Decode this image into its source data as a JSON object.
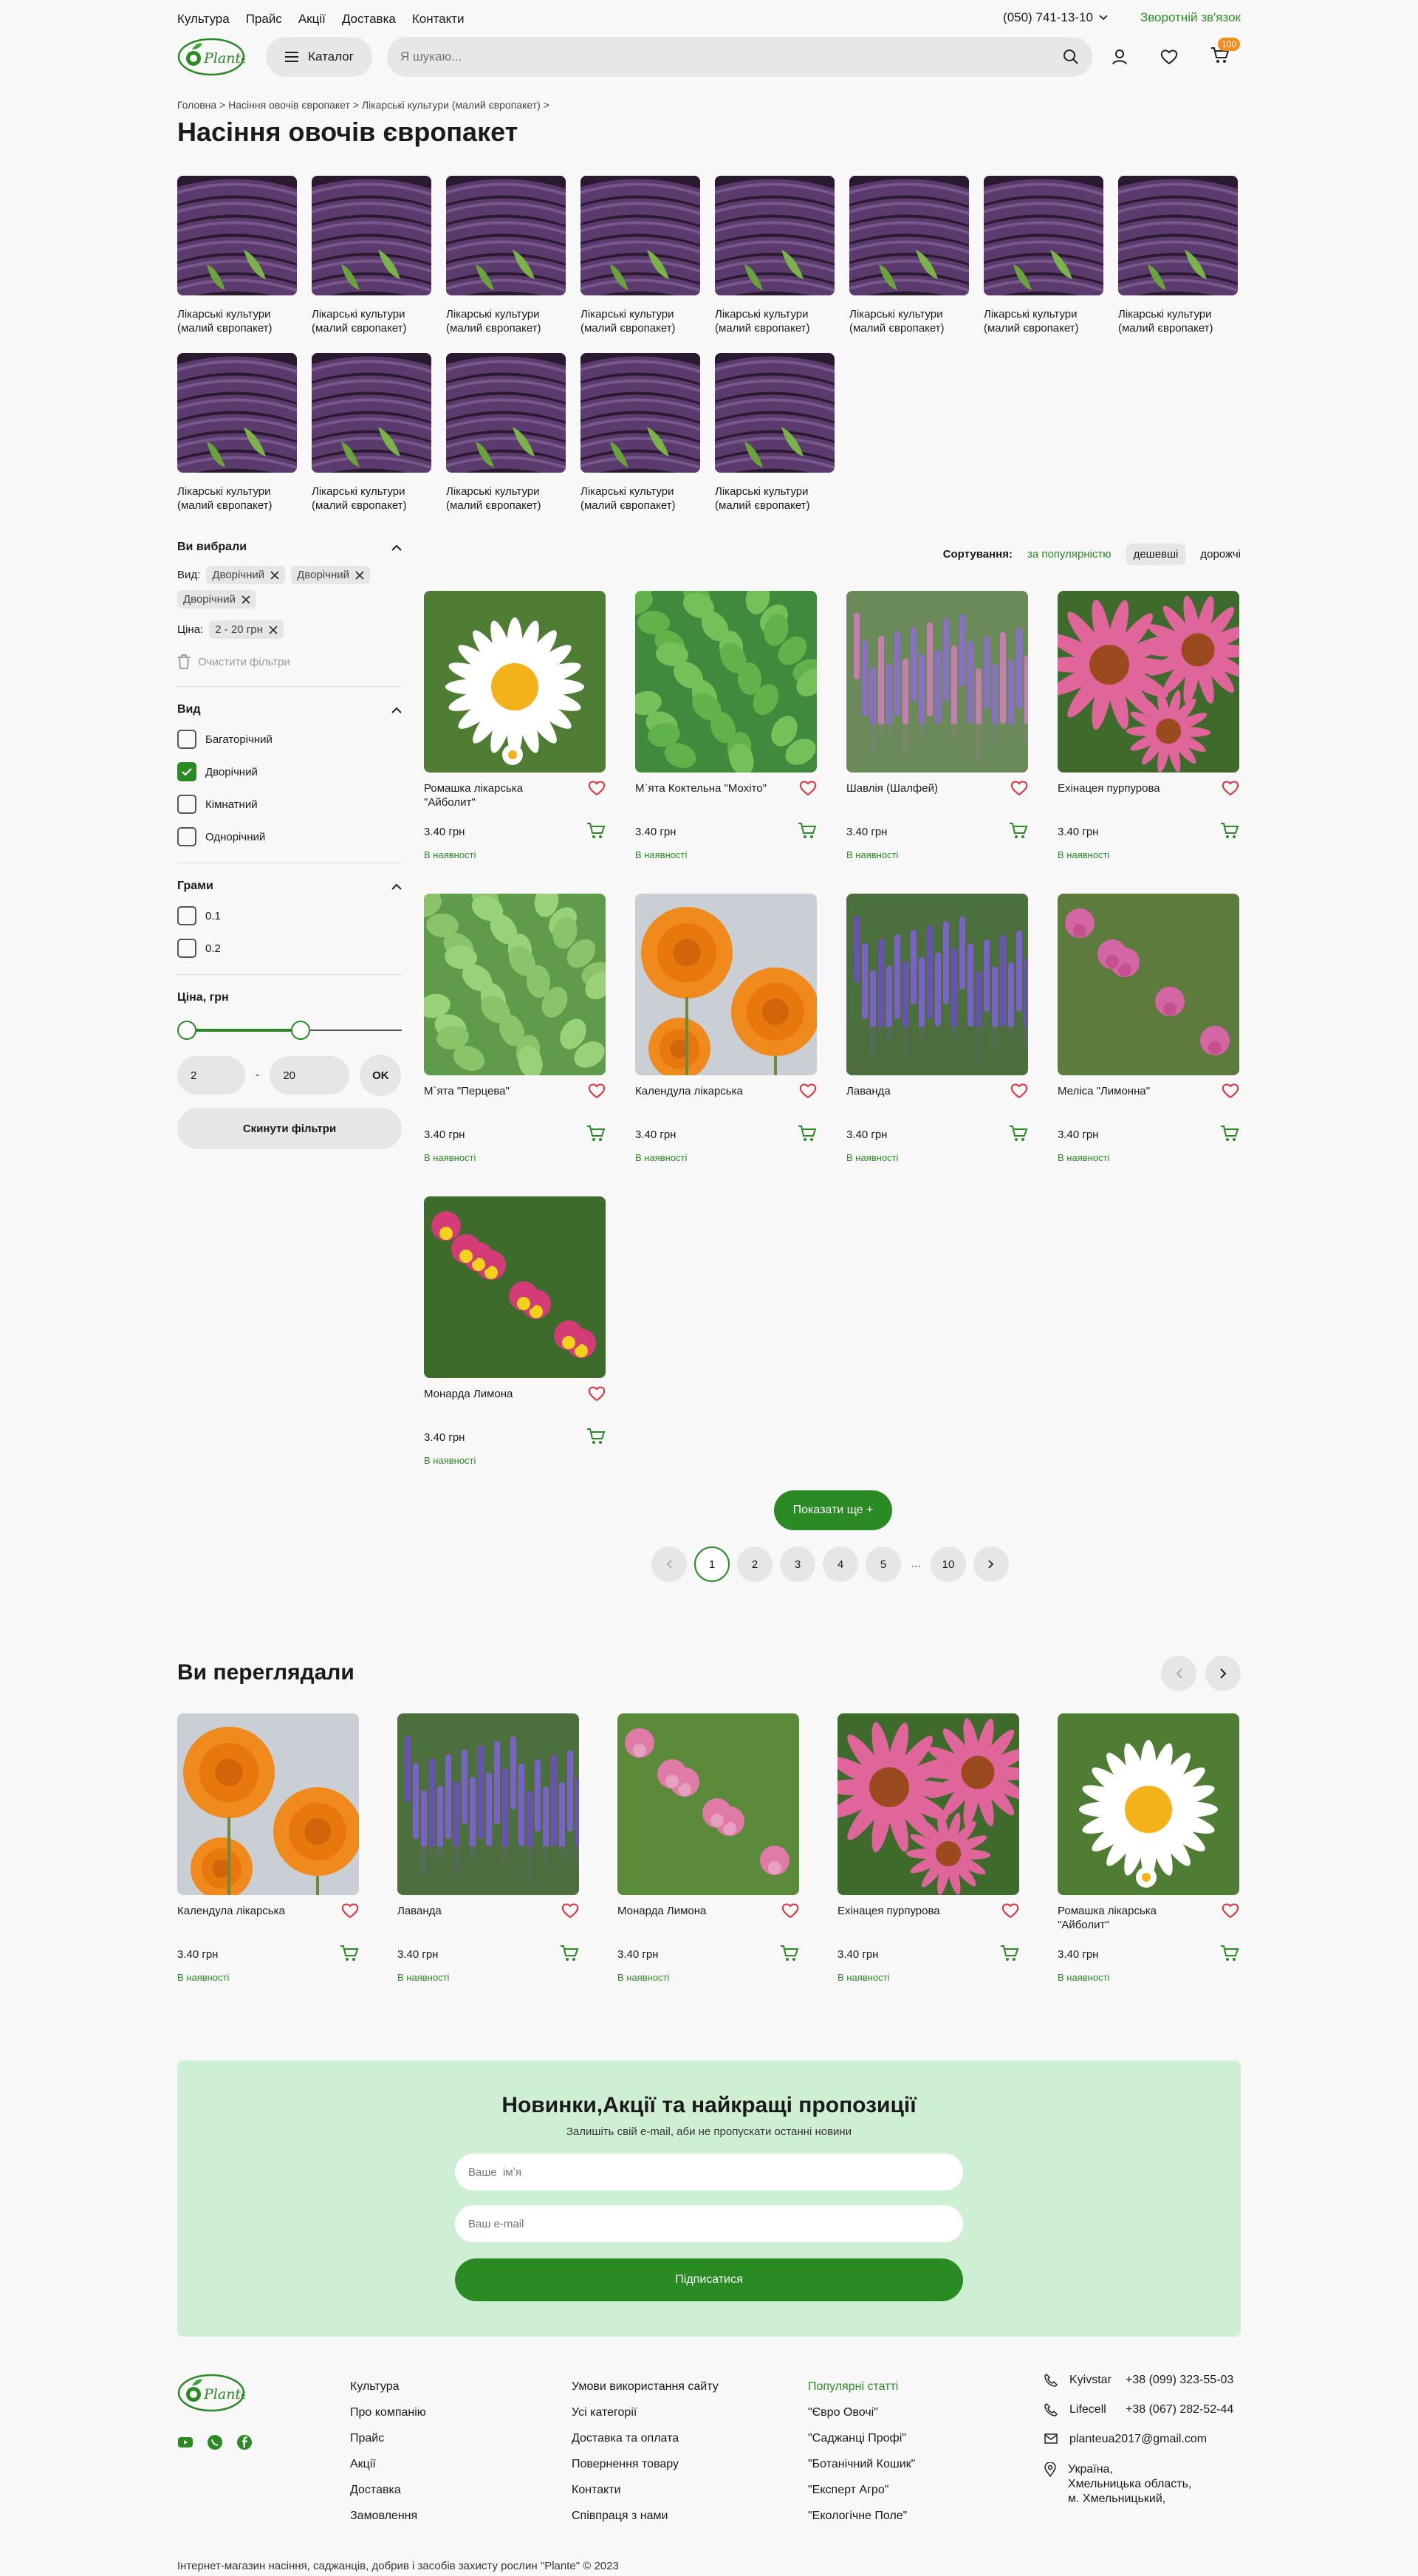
{
  "topnav": [
    "Культура",
    "Прайс",
    "Акції",
    "Доставка",
    "Контакти"
  ],
  "header": {
    "phone": "(050) 741-13-10",
    "feedback": "Зворотній зв'язок",
    "catalog": "Каталог",
    "search_placeholder": "Я шукаю...",
    "cart_count": "100",
    "logo_text": "Plante"
  },
  "breadcrumb": "Головна > Насіння овочів європакет > Лікарські культури (малий європакет) >",
  "title": "Насіння овочів європакет",
  "categories": [
    "Лікарські культури (малий європакет)",
    "Лікарські культури (малий європакет)",
    "Лікарські культури (малий європакет)",
    "Лікарські культури (малий європакет)",
    "Лікарські культури (малий європакет)",
    "Лікарські культури (малий європакет)",
    "Лікарські культури (малий європакет)",
    "Лікарські культури (малий європакет)",
    "Лікарські культури (малий європакет)",
    "Лікарські культури (малий європакет)",
    "Лікарські культури (малий європакет)",
    "Лікарські культури (малий європакет)",
    "Лікарські культури (малий європакет)"
  ],
  "filters": {
    "selected_title": "Ви вибрали",
    "vid_label": "Вид:",
    "vid_chips": [
      "Дворічний",
      "Дворічний",
      "Дворічний"
    ],
    "price_label": "Ціна:",
    "price_chip": "2 - 20 грн",
    "clear": "Очистити фільтри",
    "vid_title": "Вид",
    "vid_options": [
      "Багаторічний",
      "Дворічний",
      "Кімнатний",
      "Однорічний"
    ],
    "vid_checked": 1,
    "grams_title": "Грами",
    "grams_options": [
      "0.1",
      "0.2"
    ],
    "price_title": "Ціна, грн",
    "price_from": "2",
    "price_to": "20",
    "price_sep": "-",
    "ok": "OK",
    "reset": "Скинути фільтри"
  },
  "sort": {
    "label": "Сортування:",
    "options": [
      "за популярністю",
      "дешевші",
      "дорожчі"
    ]
  },
  "products": [
    {
      "name": "Ромашка лікарська \"Айболит\"",
      "price": "3.40 грн",
      "stock": "В наявності",
      "img": "daisy"
    },
    {
      "name": "М`ята Коктельна \"Мохіто\"",
      "price": "3.40 грн",
      "stock": "В наявності",
      "img": "mint"
    },
    {
      "name": "Шавлія (Шалфей)",
      "price": "3.40 грн",
      "stock": "В наявності",
      "img": "sage"
    },
    {
      "name": "Ехінацея пурпурова",
      "price": "3.40 грн",
      "stock": "В наявності",
      "img": "echinacea"
    },
    {
      "name": "М`ята \"Перцева\"",
      "price": "3.40 грн",
      "stock": "В наявності",
      "img": "pepmint"
    },
    {
      "name": "Календула лікарська",
      "price": "3.40 грн",
      "stock": "В наявності",
      "img": "calendula"
    },
    {
      "name": "Лаванда",
      "price": "3.40 грн",
      "stock": "В наявності",
      "img": "lavender"
    },
    {
      "name": "Меліса \"Лимонна\"",
      "price": "3.40 грн",
      "stock": "В наявності",
      "img": "melissa"
    },
    {
      "name": "Монарда Лимона",
      "price": "3.40 грн",
      "stock": "В наявності",
      "img": "monarda"
    }
  ],
  "show_more": "Показати ще +",
  "pagination": [
    "1",
    "2",
    "3",
    "4",
    "5",
    "...",
    "10"
  ],
  "viewed_title": "Ви переглядали",
  "viewed": [
    {
      "name": "Календула лікарська",
      "price": "3.40 грн",
      "stock": "В наявності",
      "img": "calendula"
    },
    {
      "name": "Лаванда",
      "price": "3.40 грн",
      "stock": "В наявності",
      "img": "lavender"
    },
    {
      "name": "Монарда Лимона",
      "price": "3.40 грн",
      "stock": "В наявності",
      "img": "monarda2"
    },
    {
      "name": "Ехінацея пурпурова",
      "price": "3.40 грн",
      "stock": "В наявності",
      "img": "echinacea"
    },
    {
      "name": "Ромашка лікарська \"Айболит\"",
      "price": "3.40 грн",
      "stock": "В наявності",
      "img": "daisy"
    }
  ],
  "newsletter": {
    "title": "Новинки,Акції та найкращі пропозиції",
    "subtitle": "Залишіть свій e-mail, аби не пропускати останні новини",
    "name_placeholder": "Ваше  імʼя",
    "email_placeholder": "Ваш e-mail",
    "submit": "Підписатися"
  },
  "footer": {
    "col1": [
      "Культура",
      "Про компанію",
      "Прайс",
      "Акції",
      "Доставка",
      "Замовлення"
    ],
    "col2": [
      "Умови використання сайту",
      "Усі категорії",
      "Доставка та оплата",
      "Повернення товару",
      "Контакти",
      "Співпраця з нами"
    ],
    "col3_title": "Популярні статті",
    "col3": [
      "\"Євро Овочі\"",
      "\"Саджанці Профі\"",
      "\"Ботанічний Кошик\"",
      "\"Експерт Агро\"",
      "\"Екологічне Поле\""
    ],
    "kyivstar_label": "Kyivstar",
    "kyivstar": "+38 (099) 323-55-03",
    "lifecell_label": "Lifecell",
    "lifecell": "+38 (067) 282-52-44",
    "email": "planteua2017@gmail.com",
    "address": [
      "Україна,",
      "Хмельницька область,",
      "м. Хмельницький,"
    ],
    "copyright": "Інтернет-магазин насіння, саджанців, добрив і засобів захисту рослин \"Plante\" © 2023"
  },
  "colors": {
    "accent": "#2a8a23",
    "badge": "#f28c1a",
    "newsletter_bg": "#cfefd4"
  }
}
